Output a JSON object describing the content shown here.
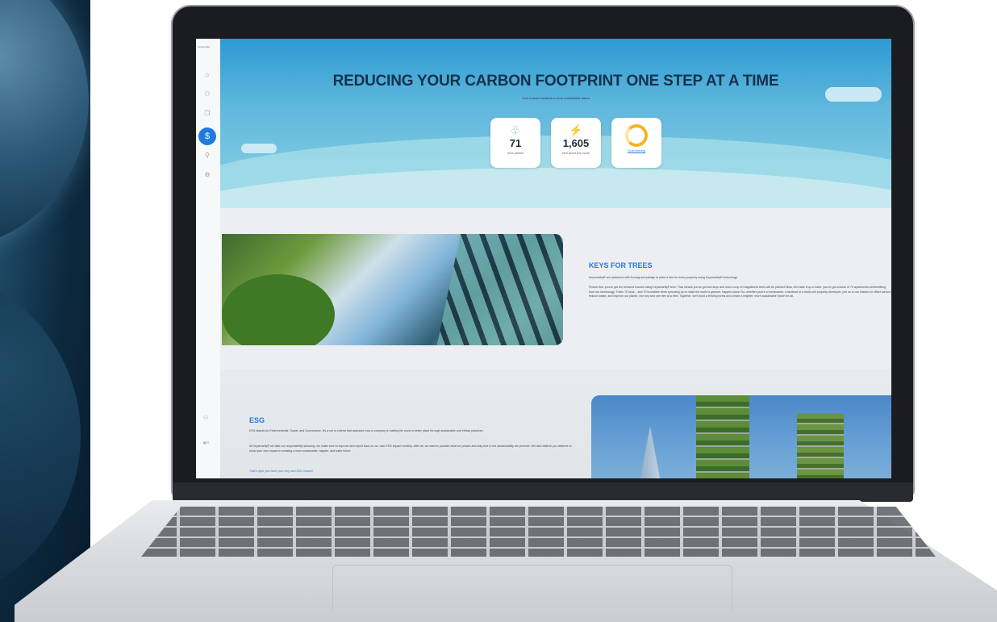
{
  "sidebar": {
    "brand": "Keysmartiq",
    "icons": [
      "home-icon",
      "people-icon",
      "layers-icon",
      "eco-coin-icon",
      "org-chart-icon",
      "settings-icon"
    ],
    "active_icon": "eco-coin-icon",
    "bottom_icons": [
      "user-icon",
      "partner-logo"
    ]
  },
  "hero": {
    "title": "REDUCING YOUR CARBON FOOTPRINT ONE STEP AT A TIME",
    "subtitle": "Your forward towards a more sustainable future",
    "stats": [
      {
        "icon": "tree-icon",
        "value": "71",
        "label": "trees planted"
      },
      {
        "icon": "lightning-icon",
        "value": "1,605",
        "label": "kWh saved this month"
      },
      {
        "icon": "ring-icon",
        "value": "",
        "label": "Good Morning"
      }
    ]
  },
  "keys_for_trees": {
    "title": "KEYS FOR TREES",
    "intro": "Keysmartiq® are partnered with Ecologi and pledge to plant a tree for every property using Keysmartiq® technology.",
    "body": "Picture this: you've got ten terraced houses using Keysmartiq® tech. That means you've got two keys and now a crop of magnificent trees will be planted! Now, let's take it up a notch: you've got a block of 70 apartments all benefiting from our technology. That's 70 keys... and 70 incredible trees sprouting up to make the world a greener, happier place! So, whether you're a homeowner, a landlord or a multi-unit property developer, join us in our mission to offset carbon, reduce waste, and improve our planet, one key and one tree at a time. Together, we'll build a thriving forest and create a brighter, more sustainable future for all."
  },
  "esg": {
    "title": "ESG",
    "p1": "ESG stands for Environmental, Social, and Governance. It's a set of criteria that assesses how a company is making the world a better place through sustainable and ethical practices.",
    "p2": "At Keysmartiq® we take our responsibility seriously, we make sure to improve and report back on our own ESG impact monthly. After all, we want to practise what we preach and stay true to the sustainability we promote. We also believe you deserve to know your own impact in creating a more sustainable, happier, and safer future.",
    "link": "That's right, you have your very own ESG impact!"
  }
}
